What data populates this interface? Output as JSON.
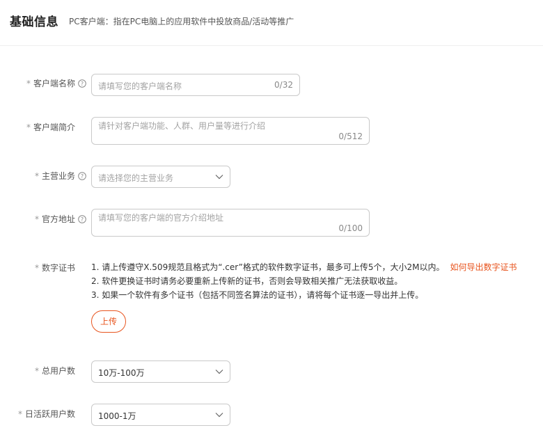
{
  "header": {
    "title": "基础信息",
    "subtitle": "PC客户端：指在PC电脑上的应用软件中投放商品/活动等推广"
  },
  "form": {
    "client_name": {
      "label": "客户端名称",
      "placeholder": "请填写您的客户端名称",
      "counter": "0/32"
    },
    "client_intro": {
      "label": "客户端简介",
      "placeholder": "请针对客户端功能、人群、用户量等进行介绍",
      "counter": "0/512"
    },
    "main_business": {
      "label": "主营业务",
      "placeholder": "请选择您的主营业务"
    },
    "official_url": {
      "label": "官方地址",
      "placeholder": "请填写您的客户端的官方介绍地址",
      "counter": "0/100"
    },
    "digital_cert": {
      "label": "数字证书",
      "line1": "1. 请上传遵守X.509规范且格式为“.cer”格式的软件数字证书，最多可上传5个，大小2M以内。",
      "link": "如何导出数字证书",
      "line2": "2. 软件更换证书时请务必要重新上传新的证书，否则会导致相关推广无法获取收益。",
      "line3": "3. 如果一个软件有多个证书（包括不同签名算法的证书），请将每个证书逐一导出并上传。",
      "upload_label": "上传"
    },
    "total_users": {
      "label": "总用户数",
      "value": "10万-100万"
    },
    "daily_active": {
      "label": "日活跃用户数",
      "value": "1000-1万"
    }
  },
  "required_mark": "*",
  "colors": {
    "accent": "#e8541e",
    "border": "#c9c9c9",
    "placeholder": "#a3a3a3"
  },
  "icons": {
    "help": "help-circle-icon",
    "dropdown": "chevron-down-icon"
  }
}
